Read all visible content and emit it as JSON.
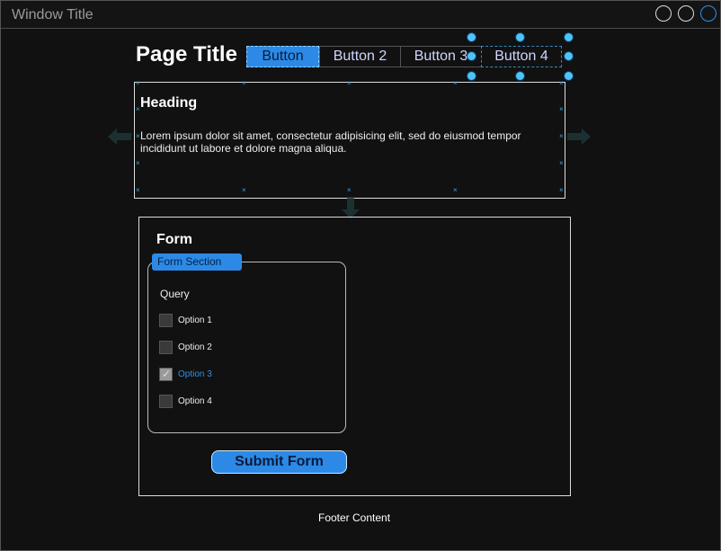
{
  "window": {
    "title": "Window Title"
  },
  "page": {
    "title": "Page Title"
  },
  "toolbar": {
    "buttons": [
      "Button",
      "Button 2",
      "Button 3",
      "Button 4"
    ]
  },
  "card": {
    "heading": "Heading",
    "text": "Lorem ipsum dolor sit amet, consectetur adipisicing elit, sed do eiusmod tempor incididunt ut labore et dolore magna aliqua."
  },
  "form": {
    "heading": "Form",
    "section_label": "Form Section",
    "query_label": "Query",
    "options": [
      {
        "label": "Option 1",
        "checked": false
      },
      {
        "label": "Option 2",
        "checked": false
      },
      {
        "label": "Option 3",
        "checked": true
      },
      {
        "label": "Option 4",
        "checked": false
      }
    ],
    "submit_label": "Submit Form"
  },
  "footer": {
    "text": "Footer Content"
  },
  "colors": {
    "accent": "#2c8ae6",
    "handle": "#4fc3f7",
    "background": "#111111"
  }
}
